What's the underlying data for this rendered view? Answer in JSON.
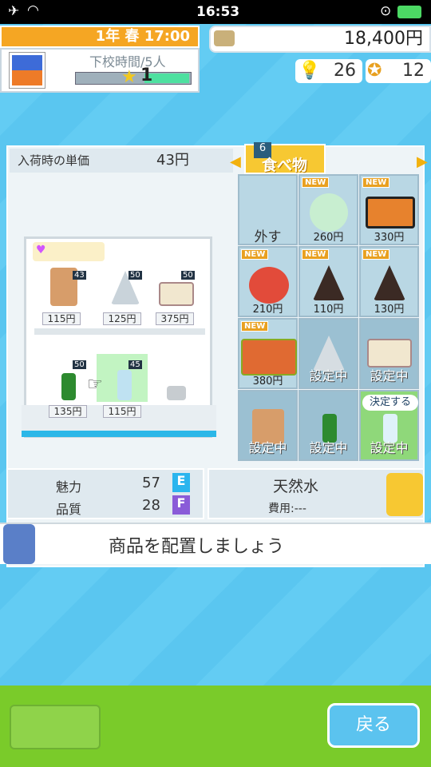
{
  "status": {
    "time": "16:53"
  },
  "header": {
    "date": "1年 春 17:00",
    "phase": "下校時間/5人",
    "level": "1",
    "money": "18,400円",
    "ideas": "26",
    "medals": "12"
  },
  "register": {
    "label": "入荷時の単価",
    "price": "43円"
  },
  "category": {
    "badge": "6",
    "name": "食べ物"
  },
  "shelf": {
    "top_prices": [
      "115円",
      "125円",
      "375円"
    ],
    "top_stock": [
      "43",
      "50",
      "50"
    ],
    "bottom_prices": [
      "135円",
      "115円"
    ],
    "bottom_stock": [
      "50",
      "45"
    ]
  },
  "grid": {
    "remove_label": "外す",
    "items": [
      {
        "price": "260円",
        "new": "NEW"
      },
      {
        "price": "330円",
        "new": "NEW"
      },
      {
        "price": "210円",
        "new": "NEW"
      },
      {
        "price": "110円",
        "new": "NEW"
      },
      {
        "price": "130円",
        "new": "NEW"
      },
      {
        "price": "380円",
        "new": "NEW"
      }
    ],
    "set_label": "設定中",
    "decide_label": "決定する"
  },
  "stats": {
    "charm_label": "魅力",
    "charm_value": "57",
    "charm_grade": "E",
    "quality_label": "品質",
    "quality_value": "28",
    "quality_grade": "F"
  },
  "selected": {
    "name": "天然水",
    "cost_label": "費用:---"
  },
  "message": "商品を配置しましょう",
  "back_label": "戻る"
}
